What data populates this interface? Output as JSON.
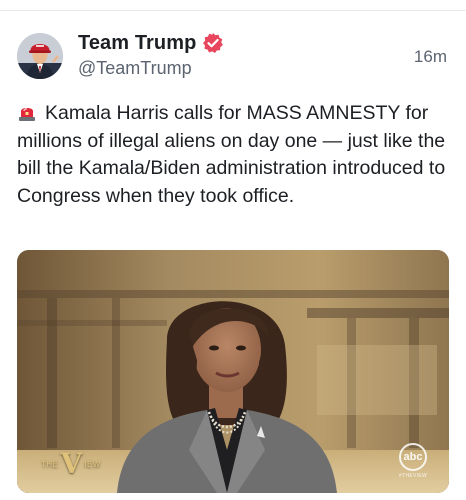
{
  "post": {
    "author": {
      "display_name": "Team Trump",
      "handle": "@TeamTrump",
      "verified_badge_color": "#e8455e",
      "avatar_icon": "profile-photo"
    },
    "timestamp": "16m",
    "text_icon": "police-light-emoji",
    "text": "Kamala Harris calls for MASS AMNESTY for millions of illegal aliens on day one — just like the bill the Kamala/Biden administration introduced to Congress when they took office.",
    "media": {
      "type": "video-still",
      "show_logo_left": "THE",
      "show_logo_mark": "V",
      "show_logo_right": "IEW",
      "network_logo": "abc",
      "network_tag": "#THEVIEW"
    }
  },
  "colors": {
    "text_primary": "#1c1f23",
    "text_secondary": "#5b6470",
    "divider": "#e6e8eb"
  }
}
